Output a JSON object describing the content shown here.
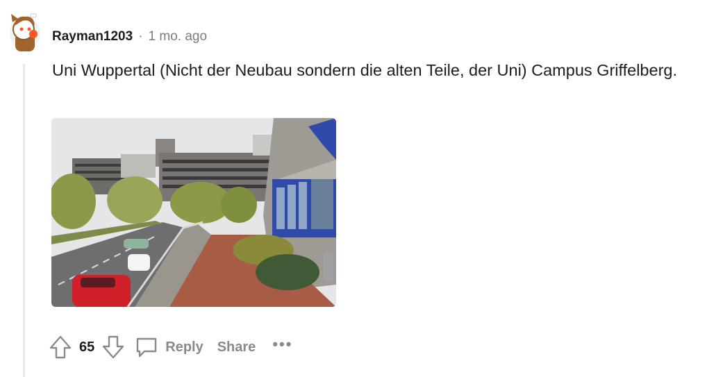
{
  "comment": {
    "author": "Rayman1203",
    "separator": "·",
    "timestamp": "1 mo. ago",
    "text": "Uni Wuppertal (Nicht der Neubau sondern die alten Teile, der Uni) Campus Griffelberg."
  },
  "actions": {
    "vote_count": "65",
    "reply_label": "Reply",
    "share_label": "Share",
    "more_label": "•••"
  },
  "colors": {
    "muted": "#878a8c",
    "thread": "#e7e9eb"
  },
  "icons": {
    "upvote": "arrow-up-outline",
    "downvote": "arrow-down-outline",
    "reply": "speech-bubble"
  }
}
